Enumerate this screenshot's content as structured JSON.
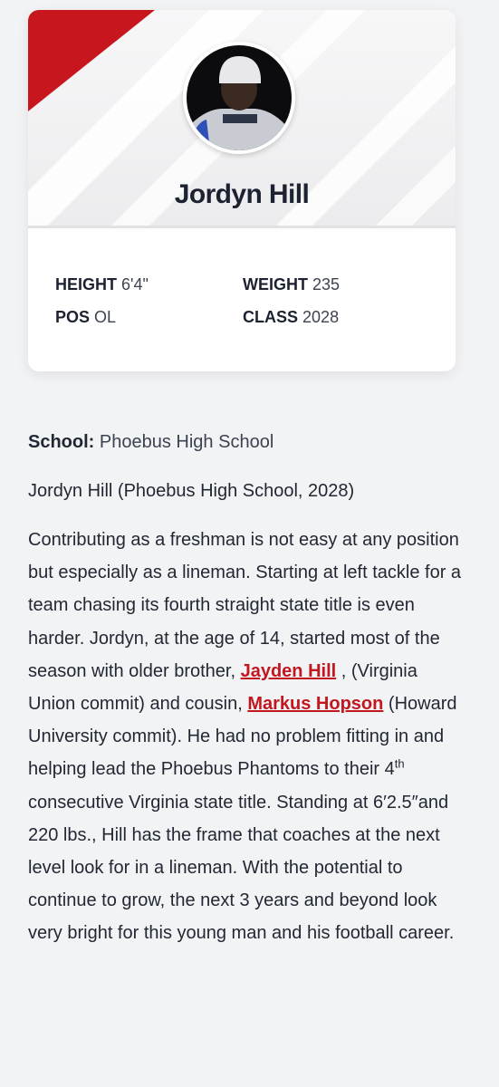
{
  "profile": {
    "name": "Jordyn Hill",
    "stats": {
      "height_label": "HEIGHT",
      "height_value": "6'4\"",
      "weight_label": "WEIGHT",
      "weight_value": "235",
      "pos_label": "POS",
      "pos_value": "OL",
      "class_label": "CLASS",
      "class_value": "2028"
    },
    "accent_color": "#c8161e"
  },
  "content": {
    "school_label": "School:",
    "school_value": "Phoebus High School",
    "intro": "Jordyn Hill (Phoebus High School, 2028)",
    "body": {
      "part1": "Contributing as a freshman is not easy at any position but especially as a lineman. Starting at left tackle for a team chasing its fourth straight state title is even harder. Jordyn, at the age of 14, started most of the season with older brother, ",
      "link1": "Jayden Hill",
      "part2": " , (Virginia Union commit) and cousin, ",
      "link2": "Markus Hopson",
      "part3": " (Howard University commit). He had no problem fitting in and helping lead the Phoebus Phantoms to their 4",
      "sup": "th",
      "part4": " consecutive Virginia state title.  Standing at 6′2.5″and 220 lbs., Hill has the frame that coaches at the next level look for in a lineman. With the potential to continue to grow, the next 3 years and beyond look very bright for this young man and his football career."
    }
  }
}
